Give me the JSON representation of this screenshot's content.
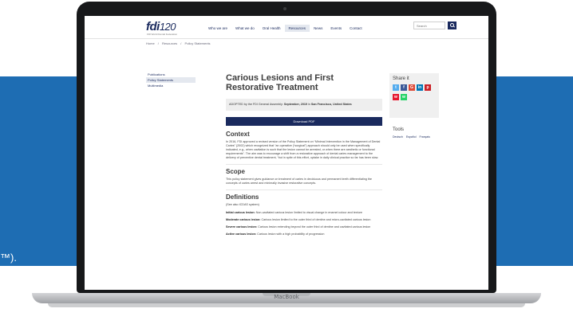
{
  "background": {
    "band_color": "#1e6db3",
    "text": "™)."
  },
  "device": {
    "brand": "MacBook"
  },
  "header": {
    "logo": "fdi",
    "logo_suffix": "120",
    "logo_sub": "FDI World Dental Federation",
    "nav": [
      "Who we are",
      "What we do",
      "Oral Health",
      "Resources",
      "News",
      "Events",
      "Contact"
    ],
    "active_nav": "Resources",
    "search_placeholder": "Search"
  },
  "breadcrumb": [
    "Home",
    "/",
    "Resources",
    "/",
    "Policy Statements"
  ],
  "left_nav": [
    "Publications",
    "Policy Statements",
    "Multimedia"
  ],
  "main": {
    "title": "Carious Lesions and First Restorative Treatment",
    "adopted_prefix": "ADOPTED by the FDI General Assembly: ",
    "adopted_date": "September, 2019",
    "adopted_mid": " in ",
    "adopted_place": "San Francisco, United States",
    "download_label": "Download PDF",
    "context_heading": "Context",
    "context_text": "In 2016, FDI approved a revised version of the Policy Statement on “Minimal Intervention in the Management of Dental Caries” (2002) which recognized that “an operative (“surgical”) approach should only be used when specifically indicated, e.g., when cavitation is such that the lesion cannot be arrested, or when there are aesthetic or functional requirements”. The aim was to encourage a shift from a restorative approach of dental caries management to the delivery of preventive dental treatment, “but in spite of this effort, uptake in daily clinical practice so far has been slow.",
    "scope_heading": "Scope",
    "scope_text": "This policy statement gives guidance on treatment of caries in deciduous and permanent teeth differentiating the concepts of caries arrest and minimally invasive restorative concepts.",
    "definitions_heading": "Definitions",
    "definitions_intro": "(See also ICDAS system)",
    "definitions": [
      {
        "term": "Initial carious lesion:",
        "text": " Non-cavitated carious lesion limited to visual change in enamel colour and texture"
      },
      {
        "term": "Moderate carious lesion:",
        "text": " Carious lesion limited to the outer third of dentine and micro-cavitated carious lesion"
      },
      {
        "term": "Severe carious lesion:",
        "text": " Carious lesion extending beyond the outer third of dentine and cavitated carious lesion"
      },
      {
        "term": "Active carious lesion:",
        "text": " Carious lesion with a high probability of progression"
      }
    ]
  },
  "sidebar": {
    "share_title": "Share it",
    "share_buttons": [
      {
        "icon": "twitter-icon",
        "glyph": "t",
        "color": "#55acee"
      },
      {
        "icon": "facebook-icon",
        "glyph": "f",
        "color": "#3b5998"
      },
      {
        "icon": "google-plus-icon",
        "glyph": "G",
        "color": "#dd4b39"
      },
      {
        "icon": "linkedin-icon",
        "glyph": "in",
        "color": "#0077b5"
      },
      {
        "icon": "pinterest-icon",
        "glyph": "p",
        "color": "#cb2027"
      },
      {
        "icon": "weibo-icon",
        "glyph": "w",
        "color": "#e6162d"
      },
      {
        "icon": "whatsapp-icon",
        "glyph": "w",
        "color": "#25d366"
      }
    ],
    "tools_title": "Tools",
    "tools_links": [
      "Deutsch",
      "Español",
      "Français"
    ]
  }
}
